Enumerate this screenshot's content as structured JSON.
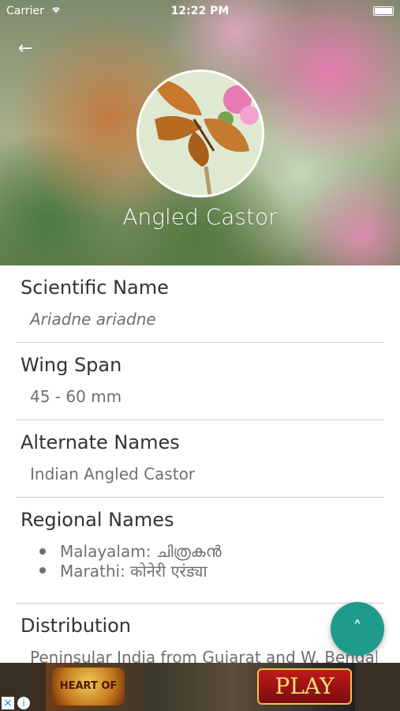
{
  "status_bar": {
    "carrier": "Carrier",
    "time": "12:22 PM"
  },
  "header": {
    "back_icon": "arrow-left-icon",
    "title": "Angled Castor"
  },
  "sections": {
    "scientific": {
      "title": "Scientific Name",
      "value": "Ariadne ariadne"
    },
    "wingspan": {
      "title": "Wing Span",
      "value": "45 - 60 mm"
    },
    "alternate": {
      "title": "Alternate Names",
      "value": "Indian Angled Castor"
    },
    "regional": {
      "title": "Regional Names",
      "items": [
        "Malayalam: ചിത്രകൻ",
        "Marathi: कोनेरी एरंड्या"
      ]
    },
    "distribution": {
      "title": "Distribution",
      "value": "Peninsular India from Gujarat and W. Bengal to"
    }
  },
  "fab": {
    "icon": "chevron-up-icon",
    "label": "˄",
    "color": "#1f9b8b"
  },
  "ad": {
    "logo_text": "HEART OF HONOR",
    "play_label": "PLAY",
    "close_label": "×",
    "info_label": "i"
  }
}
